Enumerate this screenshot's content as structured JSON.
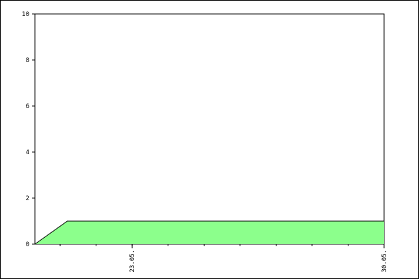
{
  "chart_data": {
    "type": "area",
    "title": "",
    "xlabel": "",
    "ylabel": "",
    "ylim": [
      0,
      10
    ],
    "yticks": [
      0,
      2,
      4,
      6,
      8,
      10
    ],
    "xticks": [
      {
        "label": "23.05.",
        "day": 23
      },
      {
        "label": "30.05.",
        "day": 30
      }
    ],
    "xlim_days": [
      20.3,
      30
    ],
    "grid": false,
    "series": [
      {
        "color": "#8cff8c",
        "points": [
          {
            "day": 20.3,
            "value": 0
          },
          {
            "day": 21.2,
            "value": 1
          },
          {
            "day": 30,
            "value": 1
          }
        ]
      }
    ]
  }
}
